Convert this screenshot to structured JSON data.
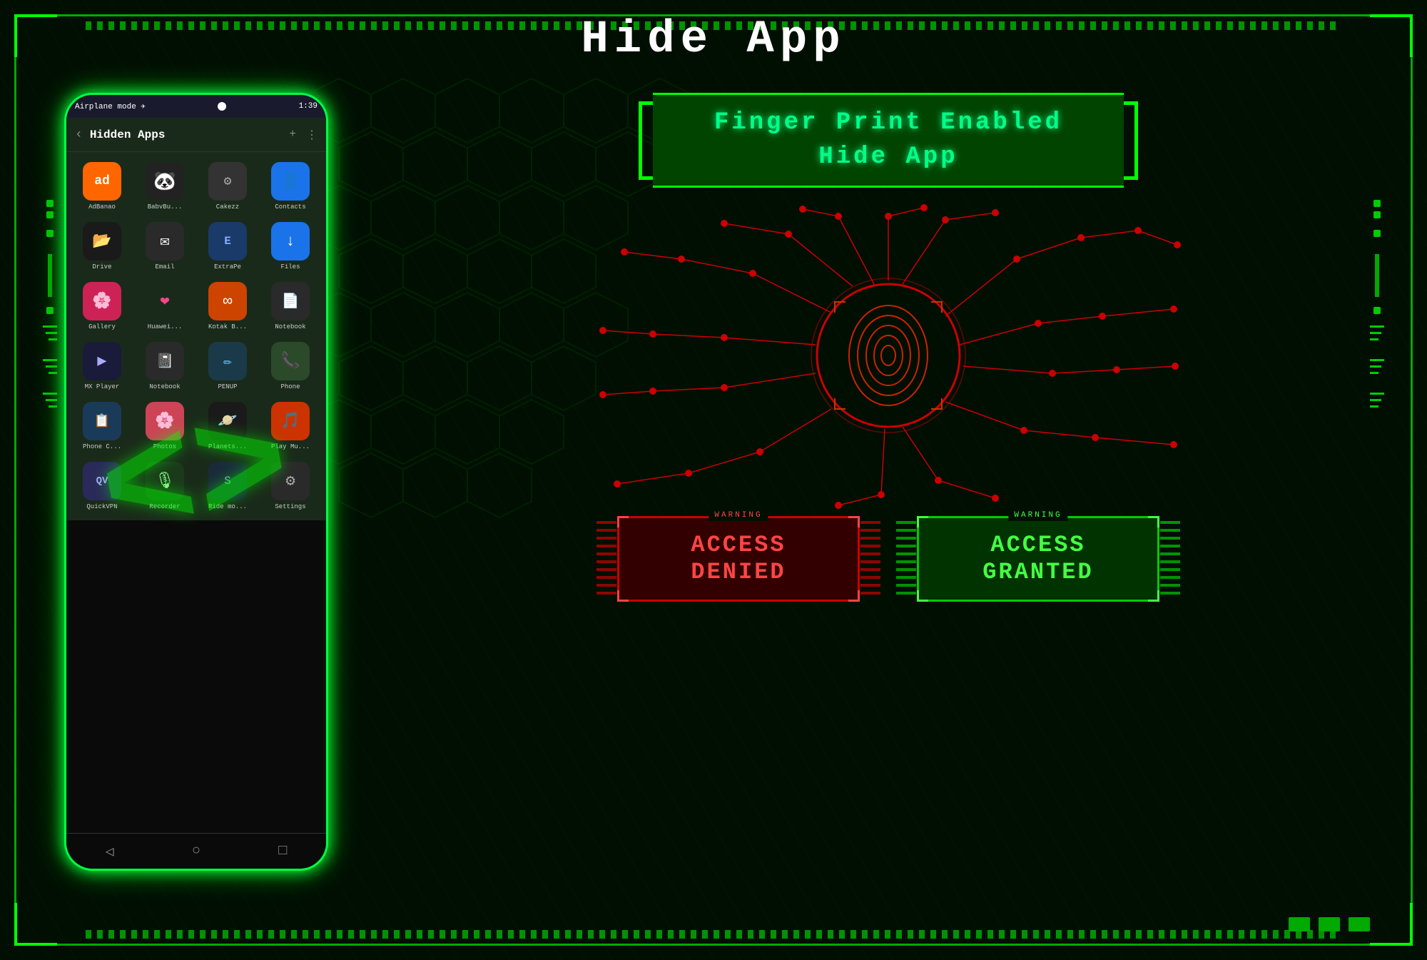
{
  "page": {
    "title": "Hide App",
    "background_color": "#010f03"
  },
  "fingerprint_section": {
    "title_line1": "Finger Print Enabled",
    "title_line2": "Hide App"
  },
  "phone": {
    "status_bar": {
      "left": "Airplane mode ✈",
      "right": "1:39"
    },
    "header": {
      "back": "‹",
      "title": "Hidden Apps",
      "add": "+",
      "menu": "⋮"
    },
    "apps": [
      {
        "label": "AdBanao",
        "color": "#ff6600",
        "icon": "ad"
      },
      {
        "label": "BabvBu...",
        "color": "#1a1a1a",
        "icon": "🐼"
      },
      {
        "label": "Cakezz",
        "color": "#2a2a2a",
        "icon": "⚙"
      },
      {
        "label": "Contacts",
        "color": "#1a73e8",
        "icon": "👤"
      },
      {
        "label": "Drive",
        "color": "#f4b400",
        "icon": "▲"
      },
      {
        "label": "Email",
        "color": "#2a2a2a",
        "icon": "✉"
      },
      {
        "label": "ExtraPe",
        "color": "#2a4a8a",
        "icon": "E"
      },
      {
        "label": "Files",
        "color": "#1a73e8",
        "icon": "↓"
      },
      {
        "label": "Gallery",
        "color": "#cc2255",
        "icon": "★"
      },
      {
        "label": "Huawei...",
        "color": "#1a3a1a",
        "icon": "❤"
      },
      {
        "label": "Kotak B...",
        "color": "#cc4400",
        "icon": "∞"
      },
      {
        "label": "Notebook",
        "color": "#2a2a2a",
        "icon": "📄"
      },
      {
        "label": "MX Player",
        "color": "#1a1a3a",
        "icon": "▶"
      },
      {
        "label": "Notebook",
        "color": "#2a2a2a",
        "icon": "📓"
      },
      {
        "label": "PENUP",
        "color": "#1a3a4a",
        "icon": "✏"
      },
      {
        "label": "Phone",
        "color": "#2a5a2a",
        "icon": "📞"
      },
      {
        "label": "Phone C...",
        "color": "#1a3a5a",
        "icon": "📋"
      },
      {
        "label": "Photos",
        "color": "#cc4455",
        "icon": "🌸"
      },
      {
        "label": "Planets...",
        "color": "#1a1a1a",
        "icon": "🪐"
      },
      {
        "label": "Play Mu...",
        "color": "#cc3300",
        "icon": "🎵"
      },
      {
        "label": "QuickVPN",
        "color": "#2a2a5a",
        "icon": "QV"
      },
      {
        "label": "Recorder",
        "color": "#1a3a1a",
        "icon": "🎙"
      },
      {
        "label": "Ride mo...",
        "color": "#1a2a3a",
        "icon": "S"
      },
      {
        "label": "Settings",
        "color": "#2a2a2a",
        "icon": "⚙"
      }
    ],
    "navbar": {
      "back": "◁",
      "home": "○",
      "recent": "□"
    }
  },
  "access_denied": {
    "warning_label": "WARNING",
    "text_line1": "ACCESS",
    "text_line2": "DENIED"
  },
  "access_granted": {
    "warning_label": "WARNING",
    "text_line1": "ACCESS",
    "text_line2": "GRANTED"
  },
  "bottom_squares": [
    "sq1",
    "sq2",
    "sq3"
  ]
}
